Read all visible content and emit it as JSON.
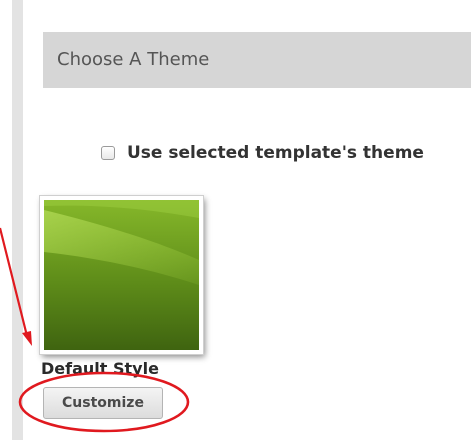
{
  "header": {
    "title": "Choose A Theme"
  },
  "template_option": {
    "label": "Use selected template's theme",
    "checked": false
  },
  "theme": {
    "name": "Default Style",
    "swatch_colors": [
      "#8fbe2f",
      "#5f8a18",
      "#3f6210"
    ]
  },
  "actions": {
    "customize_label": "Customize"
  },
  "annotation": {
    "color": "#e0191f"
  }
}
